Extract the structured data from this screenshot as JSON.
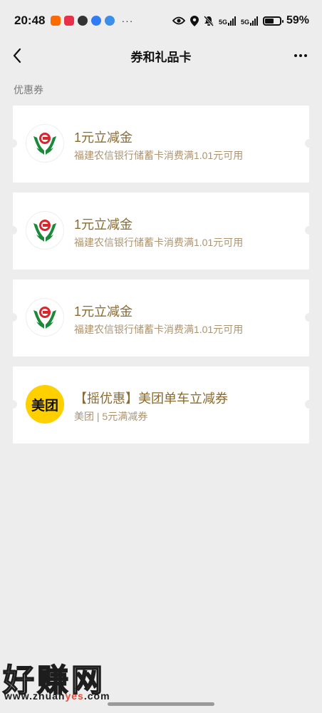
{
  "status_bar": {
    "time": "20:48",
    "signal_1": "5G",
    "signal_2": "5G",
    "battery_percent": "59%",
    "battery_level": 0.59,
    "overflow": "···"
  },
  "nav": {
    "title": "券和礼品卡"
  },
  "section": {
    "label": "优惠券"
  },
  "coupons": [
    {
      "title": "1元立减金",
      "desc": "福建农信银行储蓄卡消费满1.01元可用",
      "logo": "bank-logo-icon"
    },
    {
      "title": "1元立减金",
      "desc": "福建农信银行储蓄卡消费满1.01元可用",
      "logo": "bank-logo-icon"
    },
    {
      "title": "1元立减金",
      "desc": "福建农信银行储蓄卡消费满1.01元可用",
      "logo": "bank-logo-icon"
    },
    {
      "title": "【摇优惠】美团单车立减券",
      "desc": "美团 | 5元满减券",
      "logo_text": "美团"
    }
  ],
  "watermark": {
    "title": "好赚网",
    "url_prefix": "www.zhuan",
    "url_highlight": "yes",
    "url_suffix": ".com"
  },
  "colors": {
    "background": "#ededed",
    "coupon_title": "#8b6b2e",
    "coupon_desc": "#ad9470",
    "bank_green": "#1a8a3a",
    "bank_red": "#d9262c",
    "meituan_yellow": "#ffd000"
  }
}
